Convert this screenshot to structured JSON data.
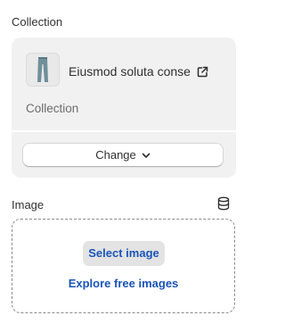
{
  "collection": {
    "heading": "Collection",
    "item_title": "Eiusmod soluta conse",
    "item_subtitle": "Collection",
    "change_label": "Change",
    "thumbnail_icon": "jeans-thumbnail",
    "external_link_icon": "external-link-icon",
    "change_icon": "chevron-down-icon"
  },
  "image": {
    "heading": "Image",
    "library_icon": "database-icon",
    "select_label": "Select image",
    "explore_label": "Explore free images"
  },
  "colors": {
    "card_background": "#f1f1f1",
    "link_blue": "#1a54b8",
    "text_primary": "#303030",
    "text_secondary": "#6d6d6d"
  }
}
